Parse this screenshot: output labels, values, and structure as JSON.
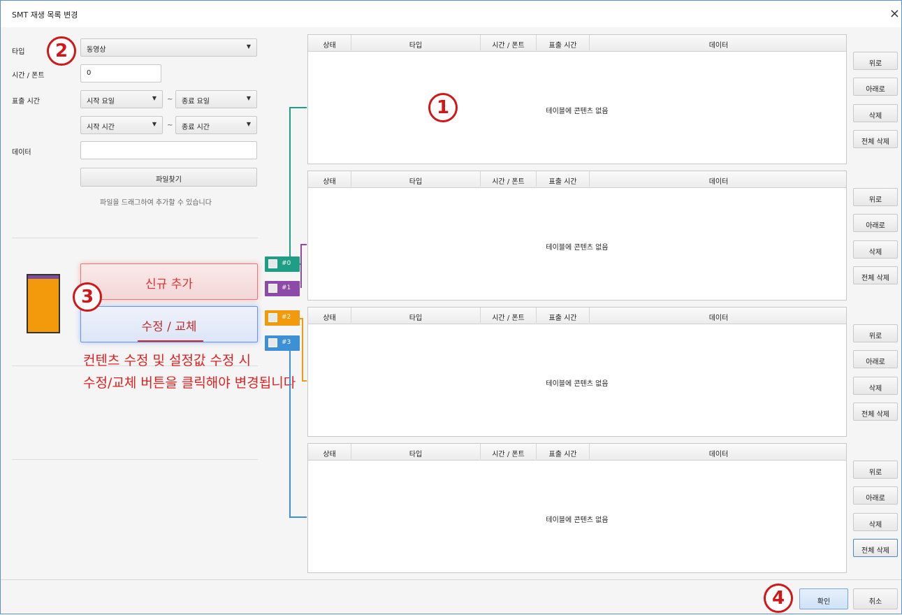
{
  "window": {
    "title": "SMT 재생 목록 변경",
    "close_glyph": "×"
  },
  "form": {
    "type_label": "타입",
    "type_value": "동영상",
    "time_font_label": "시간 / 폰트",
    "time_font_value": "0",
    "display_time_label": "표출 시간",
    "start_day": "시작 요일",
    "end_day": "종료 요일",
    "start_time": "시작 시간",
    "end_time": "종료 시간",
    "range_sep": "~",
    "data_label": "데이터",
    "data_value": "",
    "browse_button": "파일찾기",
    "drag_hint": "파일을 드래그하여 추가할 수 있습니다",
    "add_button": "신규 추가",
    "edit_button": "수정 / 교체",
    "note_line1": "컨텐츠 수정 및 설정값 수정 시",
    "note_line2": "수정/교체 버튼을 클릭해야 변경됩니다"
  },
  "annotations": {
    "n1": "1",
    "n2": "2",
    "n3": "3",
    "n4": "4"
  },
  "tags": [
    {
      "label": "#0",
      "color": "#1e9e84"
    },
    {
      "label": "#1",
      "color": "#8e4aa8"
    },
    {
      "label": "#2",
      "color": "#f39a0c"
    },
    {
      "label": "#3",
      "color": "#3d8fd6"
    }
  ],
  "tables": {
    "columns": [
      "상태",
      "타입",
      "시간 / 폰트",
      "표출 시간",
      "데이터"
    ],
    "empty_text": "테이블에 콘텐츠 없음"
  },
  "side_buttons": {
    "up": "위로",
    "down": "아래로",
    "delete": "삭제",
    "delete_all": "전체 삭제"
  },
  "footer": {
    "ok": "확인",
    "cancel": "취소"
  }
}
